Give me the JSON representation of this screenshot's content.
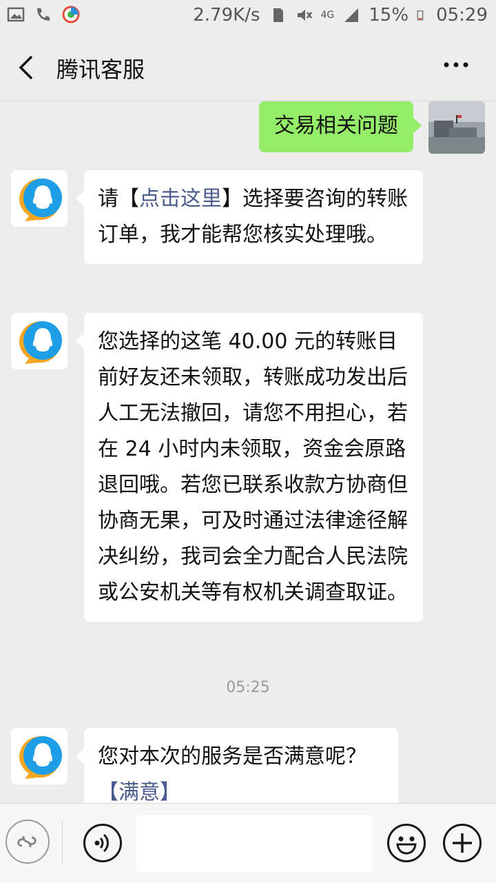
{
  "status_bar": {
    "network_speed": "2.79K/s",
    "network_type": "4G",
    "battery": "15%",
    "time": "05:29",
    "icons": [
      "image-icon",
      "call-icon",
      "app-icon",
      "sim-icon",
      "mute-icon",
      "signal-icon",
      "battery-icon"
    ]
  },
  "header": {
    "title": "腾讯客服",
    "back_icon": "chevron-left-icon",
    "more_icon": "more-dots-icon"
  },
  "messages": [
    {
      "from": "self",
      "text": "交易相关问题"
    },
    {
      "from": "bot",
      "parts": {
        "pre": "请【",
        "link": "点击这里",
        "post": "】选择要咨询的转账订单，我才能帮您核实处理哦。"
      }
    },
    {
      "from": "bot",
      "text": "您选择的这笔 40.00 元的转账目前好友还未领取，转账成功发出后人工无法撤回，请您不用担心，若在 24 小时内未领取，资金会原路退回哦。若您已联系收款方协商但协商无果，可及时通过法律途径解决纠纷，我司会全力配合人民法院或公安机关等有权机关调查取证。"
    },
    {
      "from": "time",
      "text": "05:25"
    },
    {
      "from": "bot",
      "text": "您对本次的服务是否满意呢？",
      "link": "【满意】"
    }
  ],
  "input_bar": {
    "mini_program_icon": "mini-program-icon",
    "voice_icon": "voice-icon",
    "emoji_icon": "emoji-icon",
    "plus_icon": "plus-icon",
    "input_value": ""
  },
  "colors": {
    "self_bubble": "#95ec69",
    "bot_bubble": "#ffffff",
    "link": "#4a5a8c",
    "background": "#ededed"
  }
}
